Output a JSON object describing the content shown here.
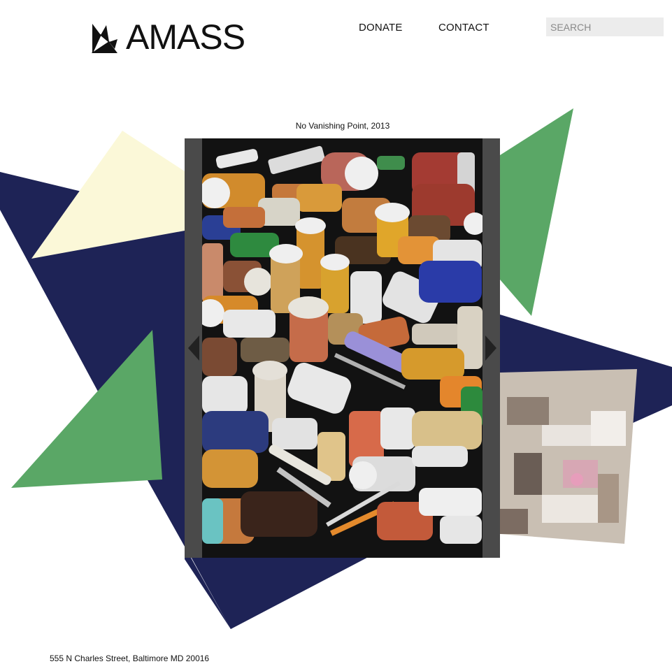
{
  "brand": {
    "name": "AMASS"
  },
  "nav": {
    "items": [
      {
        "label": "DONATE"
      },
      {
        "label": "CONTACT"
      }
    ]
  },
  "search": {
    "placeholder": "SEARCH",
    "value": ""
  },
  "slideshow": {
    "caption": "No Vanishing Point, 2013",
    "prev_icon": "chevron-left-icon",
    "next_icon": "chevron-right-icon"
  },
  "footer": {
    "address": "555 N Charles Street, Baltimore MD 20016"
  },
  "colors": {
    "navy": "#1e2356",
    "green": "#5aa766",
    "cream": "#fbf8d8",
    "frame": "#3d3d3d"
  }
}
